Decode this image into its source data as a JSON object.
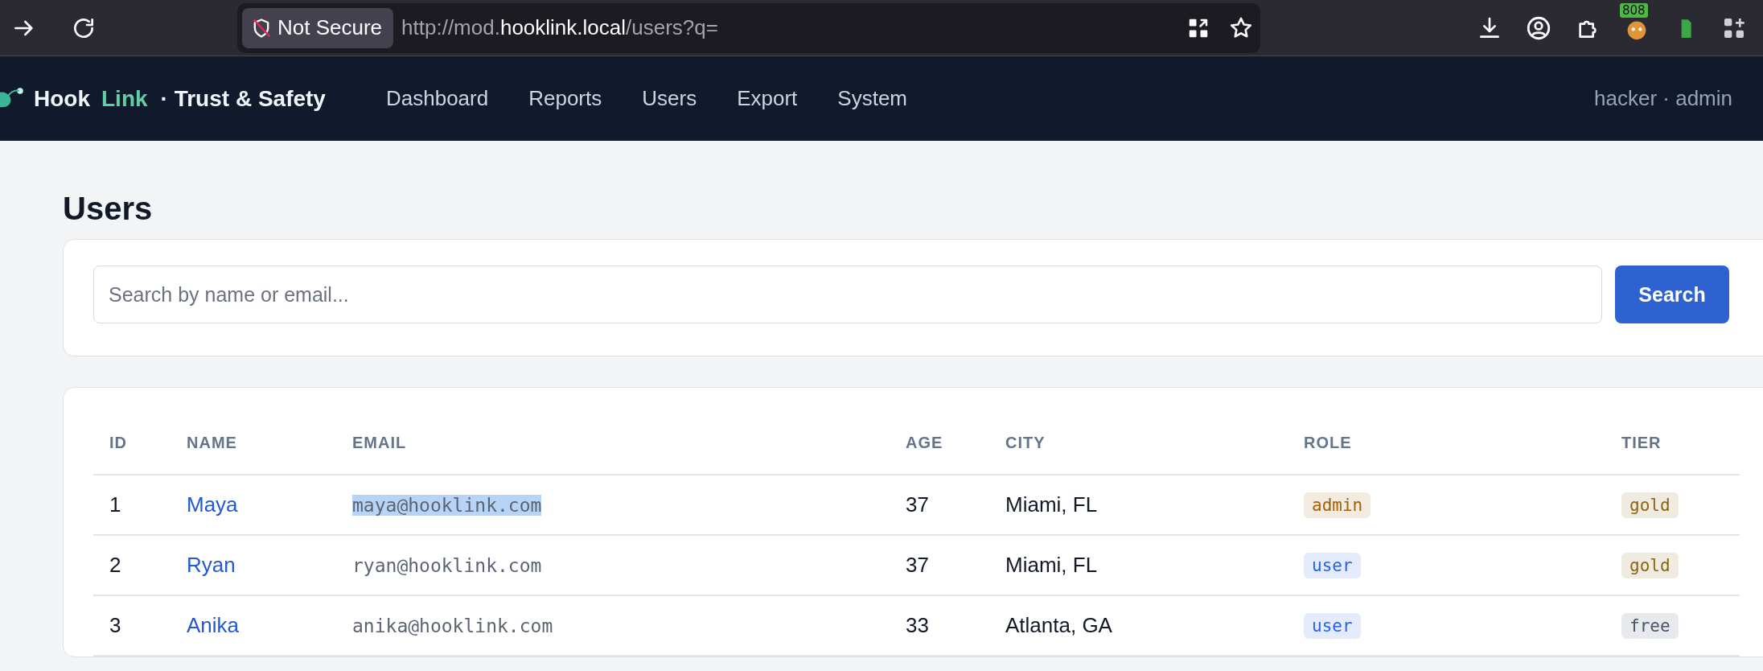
{
  "browser": {
    "security_label": "Not Secure",
    "url": {
      "prefix": "http://mod.",
      "domain": "hooklink.local",
      "path": "/users?q="
    },
    "extension_badge": "808"
  },
  "app_nav": {
    "brand": {
      "first": "Hook",
      "second": "Link",
      "suffix": "· Trust & Safety"
    },
    "links": [
      "Dashboard",
      "Reports",
      "Users",
      "Export",
      "System"
    ],
    "account": "hacker · admin"
  },
  "page": {
    "title": "Users",
    "search": {
      "placeholder": "Search by name or email...",
      "button": "Search"
    }
  },
  "table": {
    "columns": [
      "ID",
      "NAME",
      "EMAIL",
      "AGE",
      "CITY",
      "ROLE",
      "TIER"
    ],
    "rows": [
      {
        "id": "1",
        "name": "Maya",
        "email": "maya@hooklink.com",
        "email_selected": true,
        "age": "37",
        "city": "Miami, FL",
        "role": {
          "label": "admin",
          "color": "#a16207"
        },
        "tier": {
          "label": "gold",
          "color": "#8a6510"
        }
      },
      {
        "id": "2",
        "name": "Ryan",
        "email": "ryan@hooklink.com",
        "email_selected": false,
        "age": "37",
        "city": "Miami, FL",
        "role": {
          "label": "user",
          "color": "#2563eb"
        },
        "tier": {
          "label": "gold",
          "color": "#8a6510"
        }
      },
      {
        "id": "3",
        "name": "Anika",
        "email": "anika@hooklink.com",
        "email_selected": false,
        "age": "33",
        "city": "Atlanta, GA",
        "role": {
          "label": "user",
          "color": "#2563eb"
        },
        "tier": {
          "label": "free",
          "color": "#475569"
        }
      }
    ]
  }
}
